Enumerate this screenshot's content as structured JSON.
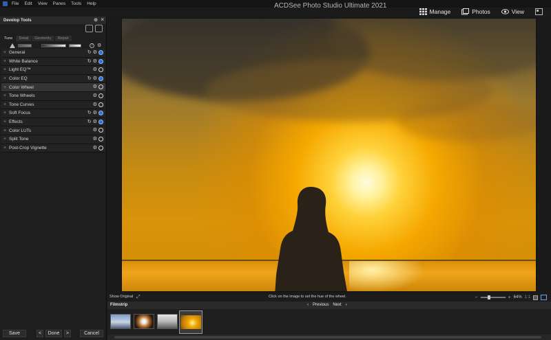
{
  "app": {
    "title": "ACDSee Photo Studio Ultimate 2021",
    "menu": [
      "File",
      "Edit",
      "View",
      "Panes",
      "Tools",
      "Help"
    ],
    "modes": [
      {
        "label": "Manage",
        "icon": "grid-icon"
      },
      {
        "label": "Photos",
        "icon": "photos-icon"
      },
      {
        "label": "View",
        "icon": "eye-icon"
      }
    ]
  },
  "panel": {
    "title": "Develop Tools",
    "tabs": [
      "Tune",
      "Detail",
      "Geometry",
      "Repair"
    ],
    "active_tab": "Tune",
    "tools": [
      {
        "label": "General",
        "reset": true,
        "enabled": true
      },
      {
        "label": "White Balance",
        "reset": true,
        "enabled": true
      },
      {
        "label": "Light EQ™",
        "reset": false,
        "enabled": false
      },
      {
        "label": "Color EQ",
        "reset": true,
        "enabled": true
      },
      {
        "label": "Color Wheel",
        "reset": false,
        "enabled": false
      },
      {
        "label": "Tone Wheels",
        "reset": false,
        "enabled": false
      },
      {
        "label": "Tone Curves",
        "reset": false,
        "enabled": false
      },
      {
        "label": "Soft Focus",
        "reset": true,
        "enabled": true
      },
      {
        "label": "Effects",
        "reset": true,
        "enabled": true
      },
      {
        "label": "Color LUTs",
        "reset": false,
        "enabled": false
      },
      {
        "label": "Split Tone",
        "reset": false,
        "enabled": false
      },
      {
        "label": "Post-Crop Vignette",
        "reset": false,
        "enabled": false
      }
    ],
    "highlighted": "Color Wheel"
  },
  "buttons": {
    "save": "Save",
    "prev": "<",
    "done": "Done",
    "next": ">",
    "cancel": "Cancel"
  },
  "status": {
    "show_original": "Show Original",
    "hint": "Click on the image to set the hue of the wheel.",
    "zoom": "64%",
    "ratio": "1:1"
  },
  "filmstrip": {
    "tab": "Filmstrip",
    "previous": "Previous",
    "next": "Next"
  }
}
